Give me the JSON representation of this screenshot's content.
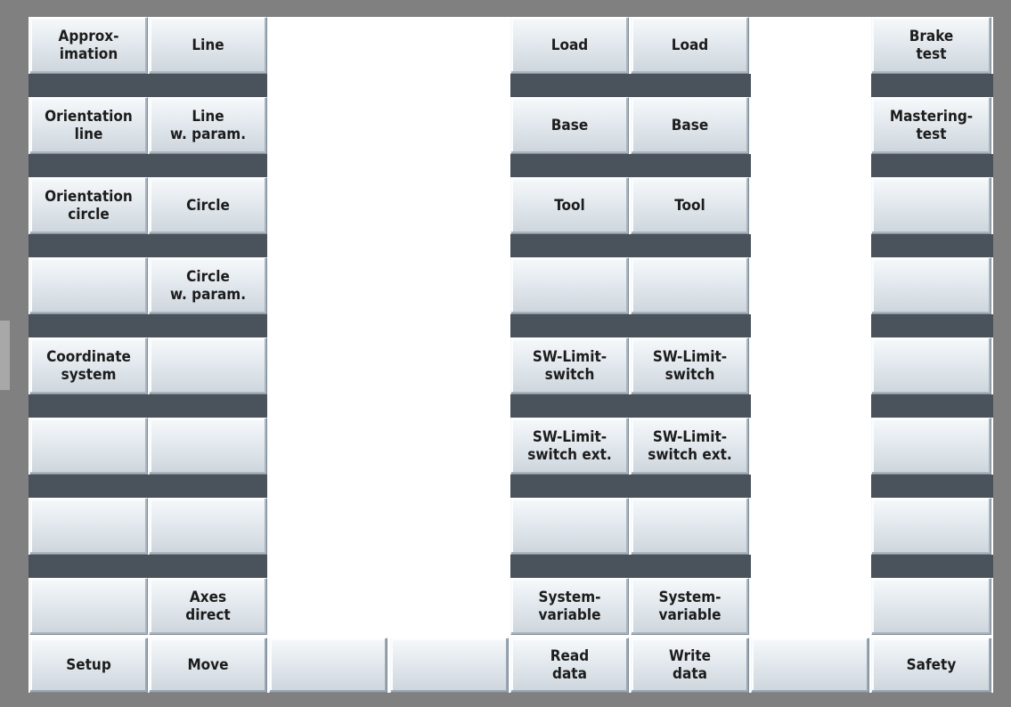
{
  "left_vertical": [
    [
      "Approx-\nimation",
      "Line"
    ],
    [
      "Orientation\nline",
      "Line\nw. param."
    ],
    [
      "Orientation\ncircle",
      "Circle"
    ],
    [
      "",
      "Circle\nw. param."
    ],
    [
      "Coordinate\nsystem",
      ""
    ],
    [
      "",
      ""
    ],
    [
      "",
      ""
    ],
    [
      "",
      "Axes\ndirect"
    ]
  ],
  "middle_vertical": [
    [
      "Load",
      "Load"
    ],
    [
      "Base",
      "Base"
    ],
    [
      "Tool",
      "Tool"
    ],
    [
      "",
      ""
    ],
    [
      "SW-Limit-\nswitch",
      "SW-Limit-\nswitch"
    ],
    [
      "SW-Limit-\nswitch ext.",
      "SW-Limit-\nswitch ext."
    ],
    [
      "",
      ""
    ],
    [
      "System-\nvariable",
      "System-\nvariable"
    ]
  ],
  "right_vertical": [
    "Brake\ntest",
    "Mastering-\ntest",
    "",
    "",
    "",
    "",
    "",
    ""
  ],
  "horizontal_softkeys": [
    "Setup",
    "Move",
    "",
    "",
    "Read\ndata",
    "Write\ndata",
    "",
    "Safety"
  ]
}
